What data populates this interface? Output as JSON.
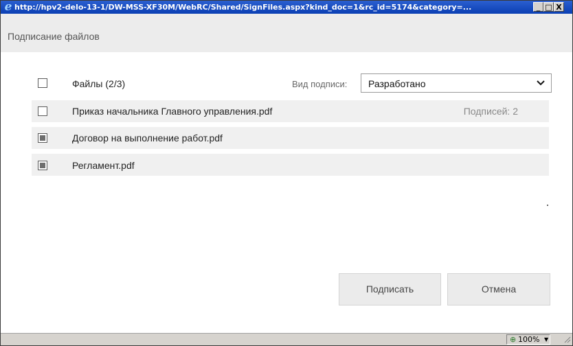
{
  "window": {
    "title_url": "http://hpv2-delo-13-1/DW-MSS-XF30M/WebRC/Shared/SignFiles.aspx?kind_doc=1&rc_id=5174&category=...",
    "minimize": "_",
    "maximize": "□",
    "close": "X"
  },
  "dialog": {
    "title": "Подписание файлов"
  },
  "files_header": {
    "label": "Файлы (2/3)",
    "checked": false
  },
  "signature_type": {
    "label": "Вид подписи:",
    "value": "Разработано"
  },
  "files": [
    {
      "name": "Приказ начальника Главного управления.pdf",
      "checked": false,
      "signatures": "Подписей: 2"
    },
    {
      "name": "Договор на выполнение работ.pdf",
      "checked": true,
      "signatures": ""
    },
    {
      "name": "Регламент.pdf",
      "checked": true,
      "signatures": ""
    }
  ],
  "buttons": {
    "sign": "Подписать",
    "cancel": "Отмена"
  },
  "statusbar": {
    "zoom": "100%",
    "zoom_arrow": "▼"
  },
  "icons": {
    "browser": "ie-icon",
    "select_arrow": "chevron-down-icon",
    "zoom": "zoom-icon",
    "resize": "resize-grip-icon"
  }
}
